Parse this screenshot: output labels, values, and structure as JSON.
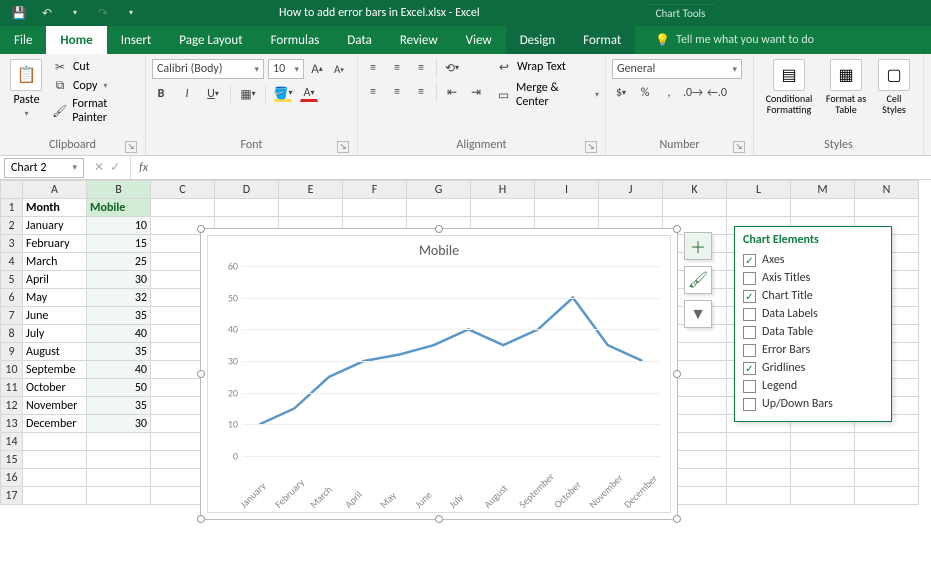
{
  "title": "How to add error bars in Excel.xlsx - Excel",
  "contextual_title": "Chart Tools",
  "tabs": [
    "File",
    "Home",
    "Insert",
    "Page Layout",
    "Formulas",
    "Data",
    "Review",
    "View",
    "Design",
    "Format"
  ],
  "active_tab": "Home",
  "tell_me": "Tell me what you want to do",
  "clipboard": {
    "paste": "Paste",
    "cut": "Cut",
    "copy": "Copy",
    "painter": "Format Painter",
    "label": "Clipboard"
  },
  "font": {
    "name": "Calibri (Body)",
    "size": "10",
    "label": "Font"
  },
  "alignment": {
    "wrap": "Wrap Text",
    "merge": "Merge & Center",
    "label": "Alignment"
  },
  "number": {
    "format": "General",
    "label": "Number"
  },
  "styles": {
    "cond": "Conditional Formatting",
    "fmt_table": "Format as Table",
    "cell": "Cell Styles",
    "label": "Styles"
  },
  "name_box": "Chart 2",
  "columns": [
    "A",
    "B",
    "C",
    "D",
    "E",
    "F",
    "G",
    "H",
    "I",
    "J",
    "K",
    "L",
    "M",
    "N"
  ],
  "header": {
    "A": "Month",
    "B": "Mobile"
  },
  "rows": [
    {
      "A": "January",
      "B": 10
    },
    {
      "A": "February",
      "B": 15
    },
    {
      "A": "March",
      "B": 25
    },
    {
      "A": "April",
      "B": 30
    },
    {
      "A": "May",
      "B": 32
    },
    {
      "A": "June",
      "B": 35
    },
    {
      "A": "July",
      "B": 40
    },
    {
      "A": "August",
      "B": 35
    },
    {
      "A": "September",
      "B": 40
    },
    {
      "A": "October",
      "B": 50
    },
    {
      "A": "November",
      "B": 35
    },
    {
      "A": "December",
      "B": 30
    }
  ],
  "chart_title": "Mobile",
  "chart_elements_title": "Chart Elements",
  "chart_elements": [
    {
      "label": "Axes",
      "checked": true
    },
    {
      "label": "Axis Titles",
      "checked": false
    },
    {
      "label": "Chart Title",
      "checked": true
    },
    {
      "label": "Data Labels",
      "checked": false
    },
    {
      "label": "Data Table",
      "checked": false
    },
    {
      "label": "Error Bars",
      "checked": false
    },
    {
      "label": "Gridlines",
      "checked": true
    },
    {
      "label": "Legend",
      "checked": false
    },
    {
      "label": "Up/Down Bars",
      "checked": false
    }
  ],
  "chart_data": {
    "type": "line",
    "title": "Mobile",
    "categories": [
      "January",
      "February",
      "March",
      "April",
      "May",
      "June",
      "July",
      "August",
      "September",
      "October",
      "November",
      "December"
    ],
    "values": [
      10,
      15,
      25,
      30,
      32,
      35,
      40,
      35,
      40,
      50,
      35,
      30
    ],
    "ylabel": "",
    "xlabel": "",
    "ylim": [
      0,
      60
    ],
    "yticks": [
      0,
      10,
      20,
      30,
      40,
      50,
      60
    ]
  }
}
